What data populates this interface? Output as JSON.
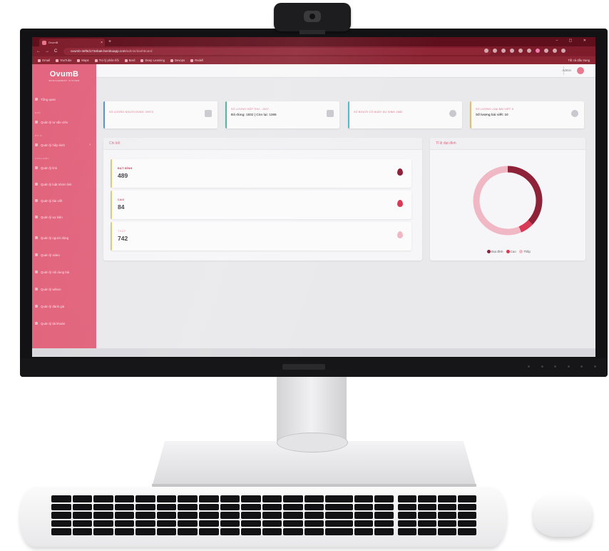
{
  "browser": {
    "tab_title": "OvumB",
    "tab_close": "×",
    "new_tab": "+",
    "window_controls": "– ▢ ✕",
    "nav": {
      "back": "←",
      "forward": "→",
      "reload": "C"
    },
    "url_host": "ovumb-3ef5d173eba6.herokuapp.com",
    "url_path": "/admin/dashboard",
    "bookmarks": [
      "Gmail",
      "YouTube",
      "Maps",
      "Trợ lý phân hồi",
      "Bard",
      "Deep Learning",
      "Devops",
      "Redefi"
    ],
    "all_bookmarks": "Tất cả dấu trang"
  },
  "sidebar": {
    "logo": "OvumB",
    "logo_sub": "MANAGEMENT SYSTEM",
    "overview": "Tổng quan",
    "section_1": "NGỪ",
    "item_1": "Quản lý tư vấn viên",
    "section_2": "DỮ ẢI",
    "item_2": "Quản lý hiệp kinh",
    "item_2_arrow": "›",
    "section_3": "CÁCH ĐIỀU",
    "items": [
      "Quản lý link",
      "Quản lý luật nhóm link",
      "Quản lý bài viết",
      "Quản lý sự kiện",
      "Quản lý người dùng",
      "Quản lý video",
      "Quản lý nội dung bài",
      "Quản lý wilson",
      "Quản lý đánh giá",
      "Quản lý tài khoản"
    ]
  },
  "topbar": {
    "admin_name": "Admin"
  },
  "stats": [
    {
      "label": "SỐ LƯỢNG NGƯỜI DÙNG: 39573",
      "value": "",
      "accent": "#5a90c8"
    },
    {
      "label": "SỐ LƯỢNG HỘP THƯ - 2807",
      "value": "Đã dùng: 1832 | Còn lại: 1365",
      "accent": "#4db09e"
    },
    {
      "label": "SỐ NGƯỜI CÓ NGÀY DỰ SINH: 1682",
      "value": "",
      "accent": "#4fb6c4"
    },
    {
      "label": "SỐ LƯỢNG LOẠI BÀI VIẾT: 5",
      "value": "Số lượng bài viết: 10",
      "accent": "#e3c05c"
    }
  ],
  "detail": {
    "title": "Chi tiết",
    "items": [
      {
        "label": "ĐẠT ĐỈNH",
        "value": "489",
        "label_color": "#c4304c",
        "drop_color": "#8e2238"
      },
      {
        "label": "CAO",
        "value": "84",
        "label_color": "#d8334d",
        "drop_color": "#d93a56"
      },
      {
        "label": "THẤP",
        "value": "742",
        "label_color": "#eeb7c2",
        "drop_color": "#f0b8c4"
      }
    ]
  },
  "chart_data": {
    "type": "pie",
    "title": "Tỉ lệ đạt đỉnh",
    "categories": [
      "Đạt đỉnh",
      "Cao",
      "Thấp"
    ],
    "values": [
      489,
      84,
      742
    ],
    "colors": [
      "#8e2238",
      "#d93a56",
      "#f0b8c4"
    ],
    "legend": "bottom"
  }
}
